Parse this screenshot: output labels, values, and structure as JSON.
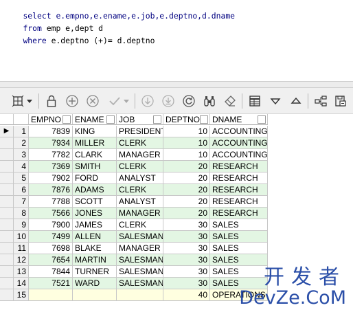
{
  "sql": {
    "line1": "select e.empno,e.ename,e.job,e.deptno,d.dname",
    "line2_kw": "from",
    "line2_rest": " emp e,dept d",
    "line3_kw": "where",
    "line3_rest": " e.deptno (+)= d.deptno"
  },
  "toolbar": {
    "icons": [
      "grid-select-icon",
      "dropdown-arrow-icon",
      "lock-icon",
      "add-record-icon",
      "delete-record-icon",
      "post-check-icon",
      "next-record-icon",
      "last-record-icon",
      "refresh-icon",
      "find-icon",
      "clear-icon",
      "spreadsheet-icon",
      "filter-down-icon",
      "filter-up-icon",
      "tree-icon",
      "export-icon"
    ]
  },
  "table": {
    "columns": [
      "EMPNO",
      "ENAME",
      "JOB",
      "DEPTNO",
      "DNAME"
    ],
    "rows": [
      {
        "n": "1",
        "empno": "7839",
        "ename": "KING",
        "job": "PRESIDENT",
        "deptno": "10",
        "dname": "ACCOUNTING"
      },
      {
        "n": "2",
        "empno": "7934",
        "ename": "MILLER",
        "job": "CLERK",
        "deptno": "10",
        "dname": "ACCOUNTING"
      },
      {
        "n": "3",
        "empno": "7782",
        "ename": "CLARK",
        "job": "MANAGER",
        "deptno": "10",
        "dname": "ACCOUNTING"
      },
      {
        "n": "4",
        "empno": "7369",
        "ename": "SMITH",
        "job": "CLERK",
        "deptno": "20",
        "dname": "RESEARCH"
      },
      {
        "n": "5",
        "empno": "7902",
        "ename": "FORD",
        "job": "ANALYST",
        "deptno": "20",
        "dname": "RESEARCH"
      },
      {
        "n": "6",
        "empno": "7876",
        "ename": "ADAMS",
        "job": "CLERK",
        "deptno": "20",
        "dname": "RESEARCH"
      },
      {
        "n": "7",
        "empno": "7788",
        "ename": "SCOTT",
        "job": "ANALYST",
        "deptno": "20",
        "dname": "RESEARCH"
      },
      {
        "n": "8",
        "empno": "7566",
        "ename": "JONES",
        "job": "MANAGER",
        "deptno": "20",
        "dname": "RESEARCH"
      },
      {
        "n": "9",
        "empno": "7900",
        "ename": "JAMES",
        "job": "CLERK",
        "deptno": "30",
        "dname": "SALES"
      },
      {
        "n": "10",
        "empno": "7499",
        "ename": "ALLEN",
        "job": "SALESMAN",
        "deptno": "30",
        "dname": "SALES"
      },
      {
        "n": "11",
        "empno": "7698",
        "ename": "BLAKE",
        "job": "MANAGER",
        "deptno": "30",
        "dname": "SALES"
      },
      {
        "n": "12",
        "empno": "7654",
        "ename": "MARTIN",
        "job": "SALESMAN",
        "deptno": "30",
        "dname": "SALES"
      },
      {
        "n": "13",
        "empno": "7844",
        "ename": "TURNER",
        "job": "SALESMAN",
        "deptno": "30",
        "dname": "SALES"
      },
      {
        "n": "14",
        "empno": "7521",
        "ename": "WARD",
        "job": "SALESMAN",
        "deptno": "30",
        "dname": "SALES"
      },
      {
        "n": "15",
        "empno": "",
        "ename": "",
        "job": "",
        "deptno": "40",
        "dname": "OPERATIONS"
      }
    ],
    "current_row_marker": "▶"
  },
  "watermark": {
    "top": "开发者",
    "bottom": "DevZe.CoM"
  }
}
